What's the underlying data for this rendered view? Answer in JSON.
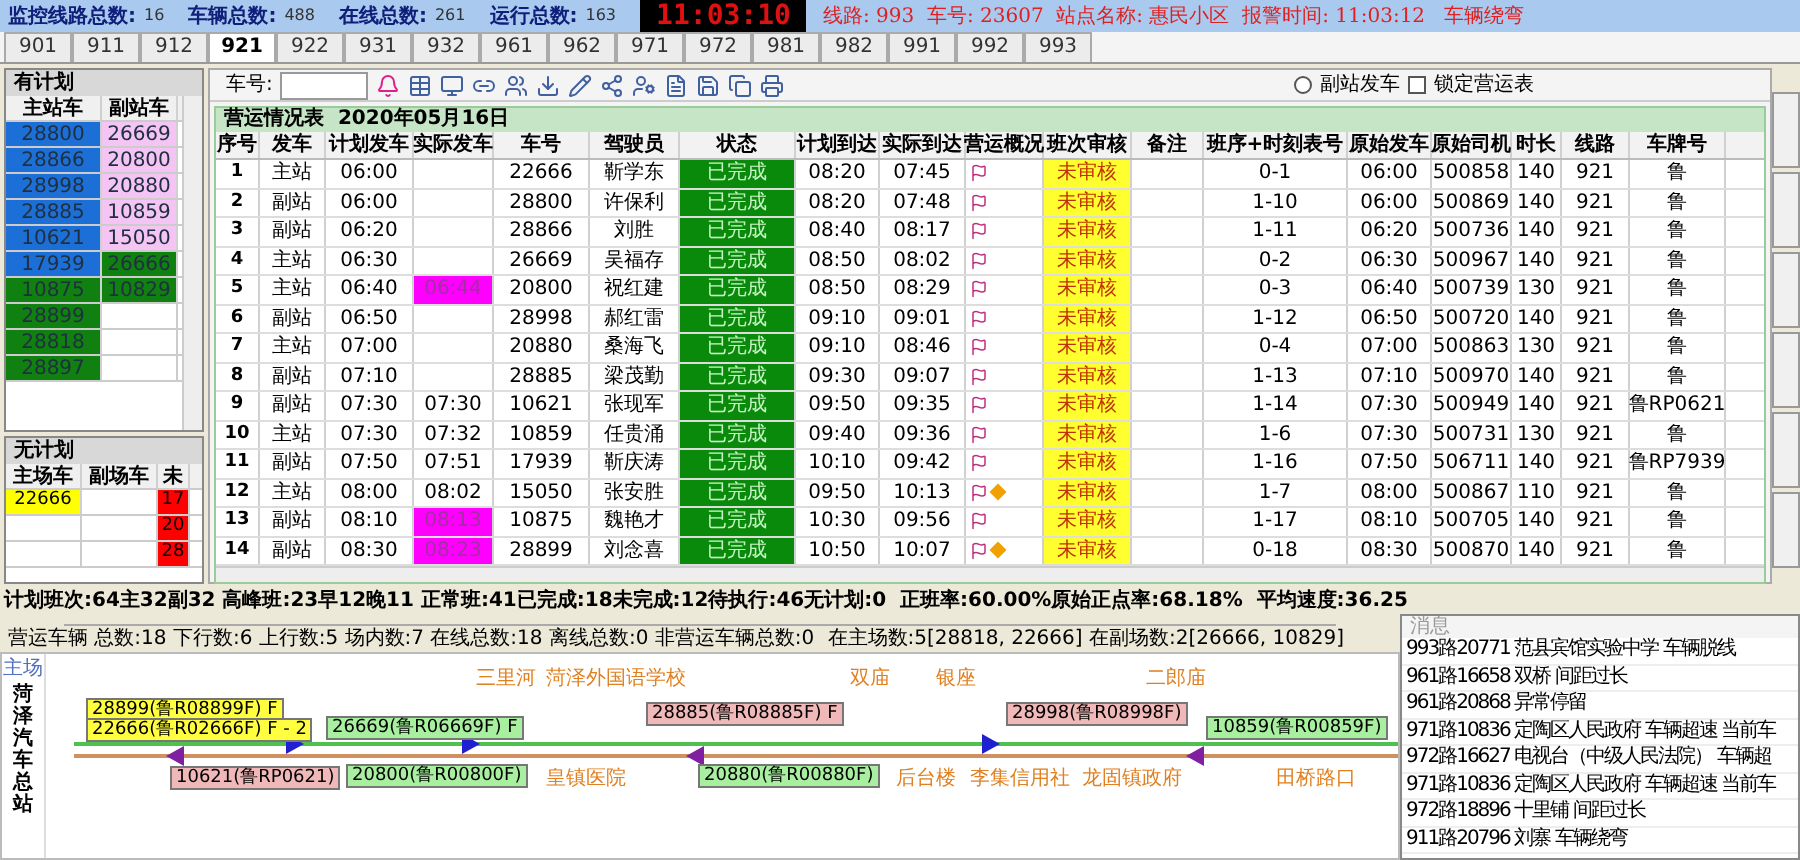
{
  "header": {
    "stats": [
      {
        "label": "监控线路总数:",
        "value": "16"
      },
      {
        "label": "车辆总数:",
        "value": "488"
      },
      {
        "label": "在线总数:",
        "value": "261"
      },
      {
        "label": "运行总数:",
        "value": "163"
      }
    ],
    "clock": "11:03:10",
    "alarm": "线路: 993  车号: 23607  站点名称: 惠民小区  报警时间: 11:03:12   车辆绕弯"
  },
  "tabs": [
    {
      "label": "901",
      "selected": false
    },
    {
      "label": "911",
      "selected": false
    },
    {
      "label": "912",
      "selected": false
    },
    {
      "label": "921",
      "selected": true
    },
    {
      "label": "922",
      "selected": false
    },
    {
      "label": "931",
      "selected": false
    },
    {
      "label": "932",
      "selected": false
    },
    {
      "label": "961",
      "selected": false
    },
    {
      "label": "962",
      "selected": false
    },
    {
      "label": "971",
      "selected": false
    },
    {
      "label": "972",
      "selected": false
    },
    {
      "label": "981",
      "selected": false
    },
    {
      "label": "982",
      "selected": false
    },
    {
      "label": "991",
      "selected": false
    },
    {
      "label": "992",
      "selected": false
    },
    {
      "label": "993",
      "selected": false
    }
  ],
  "planned": {
    "title": "有计划",
    "columns": [
      "主站车",
      "副站车"
    ],
    "rows": [
      [
        {
          "text": "28800",
          "color": "#1c6fd6"
        },
        {
          "text": "26669",
          "color": "#f4c4f4"
        }
      ],
      [
        {
          "text": "28866",
          "color": "#1c6fd6"
        },
        {
          "text": "20800",
          "color": "#f4c4f4"
        }
      ],
      [
        {
          "text": "28998",
          "color": "#1c6fd6"
        },
        {
          "text": "20880",
          "color": "#f4c4f4"
        }
      ],
      [
        {
          "text": "28885",
          "color": "#1c6fd6"
        },
        {
          "text": "10859",
          "color": "#f4c4f4"
        }
      ],
      [
        {
          "text": "10621",
          "color": "#1c6fd6"
        },
        {
          "text": "15050",
          "color": "#f4c4f4"
        }
      ],
      [
        {
          "text": "17939",
          "color": "#1c6fd6"
        },
        {
          "text": "26666",
          "color": "#108010"
        }
      ],
      [
        {
          "text": "10875",
          "color": "#108010"
        },
        {
          "text": "10829",
          "color": "#108010"
        }
      ],
      [
        {
          "text": "28899",
          "color": "#108010"
        },
        null
      ],
      [
        {
          "text": "28818",
          "color": "#108010"
        },
        null
      ],
      [
        {
          "text": "28897",
          "color": "#108010"
        },
        null
      ]
    ]
  },
  "unplanned": {
    "title": "无计划",
    "columns": [
      "主场车",
      "副场车",
      "未"
    ],
    "rows": [
      [
        {
          "text": "22666",
          "color": "#ffff00"
        },
        null,
        {
          "text": "17",
          "color": "#ff0000"
        }
      ],
      [
        null,
        null,
        {
          "text": "20",
          "color": "#ff0000"
        }
      ],
      [
        null,
        null,
        {
          "text": "28",
          "color": "#ff0000"
        }
      ]
    ]
  },
  "toolbar": {
    "car_label": "车号:",
    "radio": {
      "label": "副站发车",
      "selected": false
    },
    "checkbox": {
      "label": "锁定营运表",
      "checked": false
    }
  },
  "table": {
    "title": "营运情况表  2020年05月16日",
    "columns": [
      "序号",
      "发车",
      "计划发车",
      "实际发车",
      "车号",
      "驾驶员",
      "状态",
      "计划到达",
      "实际到达",
      "营运概况",
      "班次审核",
      "备注",
      "班序+时刻表号",
      "原始发车",
      "原始司机",
      "时长",
      "线路",
      "车牌号"
    ],
    "rows": [
      {
        "no": "1",
        "depart": "主站",
        "planned_depart": "06:00",
        "car": "22666",
        "driver": "靳学东",
        "status": "已完成",
        "planned_arrive": "08:20",
        "actual_arrive": "07:45",
        "warning": false,
        "audit": "未审核",
        "shift": "0-1",
        "orig_depart": "06:00",
        "orig_driver": "500858",
        "duration": "140",
        "line": "921",
        "plate": "鲁"
      },
      {
        "no": "2",
        "depart": "副站",
        "planned_depart": "06:00",
        "car": "28800",
        "driver": "许保利",
        "status": "已完成",
        "planned_arrive": "08:20",
        "actual_arrive": "07:48",
        "warning": false,
        "audit": "未审核",
        "shift": "1-10",
        "orig_depart": "06:00",
        "orig_driver": "500869",
        "duration": "140",
        "line": "921",
        "plate": "鲁"
      },
      {
        "no": "3",
        "depart": "副站",
        "planned_depart": "06:20",
        "car": "28866",
        "driver": "刘胜",
        "status": "已完成",
        "planned_arrive": "08:40",
        "actual_arrive": "08:17",
        "warning": false,
        "audit": "未审核",
        "shift": "1-11",
        "orig_depart": "06:20",
        "orig_driver": "500736",
        "duration": "140",
        "line": "921",
        "plate": "鲁"
      },
      {
        "no": "4",
        "depart": "主站",
        "planned_depart": "06:30",
        "car": "26669",
        "driver": "吴福存",
        "status": "已完成",
        "planned_arrive": "08:50",
        "actual_arrive": "08:02",
        "warning": false,
        "audit": "未审核",
        "shift": "0-2",
        "orig_depart": "06:30",
        "orig_driver": "500967",
        "duration": "140",
        "line": "921",
        "plate": "鲁"
      },
      {
        "no": "5",
        "depart": "主站",
        "planned_depart": "06:40",
        "actual_depart": "06:44",
        "late": true,
        "car": "20800",
        "driver": "祝红建",
        "status": "已完成",
        "planned_arrive": "08:50",
        "actual_arrive": "08:29",
        "warning": false,
        "audit": "未审核",
        "shift": "0-3",
        "orig_depart": "06:40",
        "orig_driver": "500739",
        "duration": "130",
        "line": "921",
        "plate": "鲁"
      },
      {
        "no": "6",
        "depart": "副站",
        "planned_depart": "06:50",
        "car": "28998",
        "driver": "郝红雷",
        "status": "已完成",
        "planned_arrive": "09:10",
        "actual_arrive": "09:01",
        "warning": false,
        "audit": "未审核",
        "shift": "1-12",
        "orig_depart": "06:50",
        "orig_driver": "500720",
        "duration": "140",
        "line": "921",
        "plate": "鲁"
      },
      {
        "no": "7",
        "depart": "主站",
        "planned_depart": "07:00",
        "car": "20880",
        "driver": "桑海飞",
        "status": "已完成",
        "planned_arrive": "09:10",
        "actual_arrive": "08:46",
        "warning": false,
        "audit": "未审核",
        "shift": "0-4",
        "orig_depart": "07:00",
        "orig_driver": "500863",
        "duration": "130",
        "line": "921",
        "plate": "鲁"
      },
      {
        "no": "8",
        "depart": "副站",
        "planned_depart": "07:10",
        "car": "28885",
        "driver": "梁茂勤",
        "status": "已完成",
        "planned_arrive": "09:30",
        "actual_arrive": "09:07",
        "warning": false,
        "audit": "未审核",
        "shift": "1-13",
        "orig_depart": "07:10",
        "orig_driver": "500970",
        "duration": "140",
        "line": "921",
        "plate": "鲁"
      },
      {
        "no": "9",
        "depart": "副站",
        "planned_depart": "07:30",
        "actual_depart": "07:30",
        "late": false,
        "car": "10621",
        "driver": "张现军",
        "status": "已完成",
        "planned_arrive": "09:50",
        "actual_arrive": "09:35",
        "warning": false,
        "audit": "未审核",
        "shift": "1-14",
        "orig_depart": "07:30",
        "orig_driver": "500949",
        "duration": "140",
        "line": "921",
        "plate": "鲁RP0621"
      },
      {
        "no": "10",
        "depart": "主站",
        "planned_depart": "07:30",
        "actual_depart": "07:32",
        "late": false,
        "car": "10859",
        "driver": "任贵涌",
        "status": "已完成",
        "planned_arrive": "09:40",
        "actual_arrive": "09:36",
        "warning": false,
        "audit": "未审核",
        "shift": "1-6",
        "orig_depart": "07:30",
        "orig_driver": "500731",
        "duration": "130",
        "line": "921",
        "plate": "鲁"
      },
      {
        "no": "11",
        "depart": "副站",
        "planned_depart": "07:50",
        "actual_depart": "07:51",
        "late": false,
        "car": "17939",
        "driver": "靳庆涛",
        "status": "已完成",
        "planned_arrive": "10:10",
        "actual_arrive": "09:42",
        "warning": false,
        "audit": "未审核",
        "shift": "1-16",
        "orig_depart": "07:50",
        "orig_driver": "506711",
        "duration": "140",
        "line": "921",
        "plate": "鲁RP7939"
      },
      {
        "no": "12",
        "depart": "主站",
        "planned_depart": "08:00",
        "actual_depart": "08:02",
        "late": false,
        "car": "15050",
        "driver": "张安胜",
        "status": "已完成",
        "planned_arrive": "09:50",
        "actual_arrive": "10:13",
        "warning": true,
        "audit": "未审核",
        "shift": "1-7",
        "orig_depart": "08:00",
        "orig_driver": "500867",
        "duration": "110",
        "line": "921",
        "plate": "鲁"
      },
      {
        "no": "13",
        "depart": "副站",
        "planned_depart": "08:10",
        "actual_depart": "08:13",
        "late": true,
        "car": "10875",
        "driver": "魏艳才",
        "status": "已完成",
        "planned_arrive": "10:30",
        "actual_arrive": "09:56",
        "warning": false,
        "audit": "未审核",
        "shift": "1-17",
        "orig_depart": "08:10",
        "orig_driver": "500705",
        "duration": "140",
        "line": "921",
        "plate": "鲁"
      },
      {
        "no": "14",
        "depart": "副站",
        "planned_depart": "08:30",
        "actual_depart": "08:23",
        "late": true,
        "car": "28899",
        "driver": "刘念喜",
        "status": "已完成",
        "planned_arrive": "10:50",
        "actual_arrive": "10:07",
        "warning": true,
        "audit": "未审核",
        "shift": "0-18",
        "orig_depart": "08:30",
        "orig_driver": "500870",
        "duration": "140",
        "line": "921",
        "plate": "鲁"
      }
    ]
  },
  "summary": "计划班次:64主32副32 高峰班:23早12晚11 正常班:41已完成:18未完成:12待执行:46无计划:0  正班率:60.00%原始正点率:68.18%  平均速度:36.25",
  "status_line": {
    "left": "营运车辆 总数:18 下行数:6 上行数:5 场内数:7 在线总数:18 离线总数:0 非营运车辆总数:0",
    "right": "在主场数:5[28818, 22666] 在副场数:2[26666, 10829]"
  },
  "map": {
    "terminal": "主场",
    "station_name": "菏泽汽车总站",
    "stops_top": [
      "三里河",
      "菏泽外国语学校",
      "双庙",
      "银座",
      "二郎庙"
    ],
    "stops_bottom": [
      "皇镇医院",
      "后台楼",
      "李集信用社",
      "龙固镇政府",
      "田桥路口"
    ],
    "buses": [
      {
        "label": "28899(鲁R08899F) F",
        "color": "#ffff40"
      },
      {
        "label": "22666(鲁R02666F) F - 2",
        "color": "#ffff40"
      },
      {
        "label": "10621(鲁RP0621)",
        "color": "#f0b8b8"
      },
      {
        "label": "26669(鲁R06669F) F",
        "color": "#a8f0a0"
      },
      {
        "label": "20800(鲁R00800F)",
        "color": "#a8f0a0"
      },
      {
        "label": "28885(鲁R08885F) F",
        "color": "#f0b8b8"
      },
      {
        "label": "20880(鲁R00880F)",
        "color": "#a8f0a0"
      },
      {
        "label": "28998(鲁R08998F)",
        "color": "#f0b8b8"
      },
      {
        "label": "10859(鲁R00859F)",
        "color": "#a8f0a0"
      }
    ]
  },
  "messages": {
    "title": "消息",
    "items": [
      "993路20771 范县宾馆实验中学 车辆脱线",
      "961路16658 双桥 间距过长",
      "961路20868 异常停留",
      "971路10836 定陶区人民政府 车辆超速 当前车",
      "972路16627 电视台（中级人民法院） 车辆超",
      "971路10836 定陶区人民政府 车辆超速 当前车",
      "972路18896 十里铺 间距过长",
      "911路20796 刘寨 车辆绕弯"
    ]
  }
}
